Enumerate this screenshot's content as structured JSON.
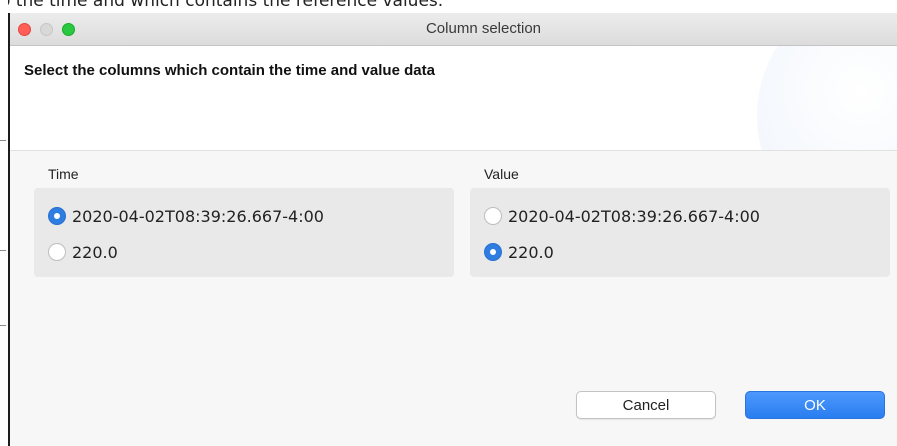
{
  "background": {
    "caption_text": "o the time and which contains the reference values."
  },
  "window": {
    "title": "Column selection"
  },
  "header": {
    "title": "Select the columns which contain the time and value data"
  },
  "time_group": {
    "label": "Time",
    "options": [
      {
        "label": "2020-04-02T08:39:26.667-4:00",
        "checked": true
      },
      {
        "label": "220.0",
        "checked": false
      }
    ]
  },
  "value_group": {
    "label": "Value",
    "options": [
      {
        "label": "2020-04-02T08:39:26.667-4:00",
        "checked": false
      },
      {
        "label": "220.0",
        "checked": true
      }
    ]
  },
  "buttons": {
    "cancel": "Cancel",
    "ok": "OK"
  },
  "colors": {
    "accent": "#2f7de1",
    "ok_button": "#3a8af7",
    "close": "#ff5f57",
    "maximize": "#28c840"
  }
}
